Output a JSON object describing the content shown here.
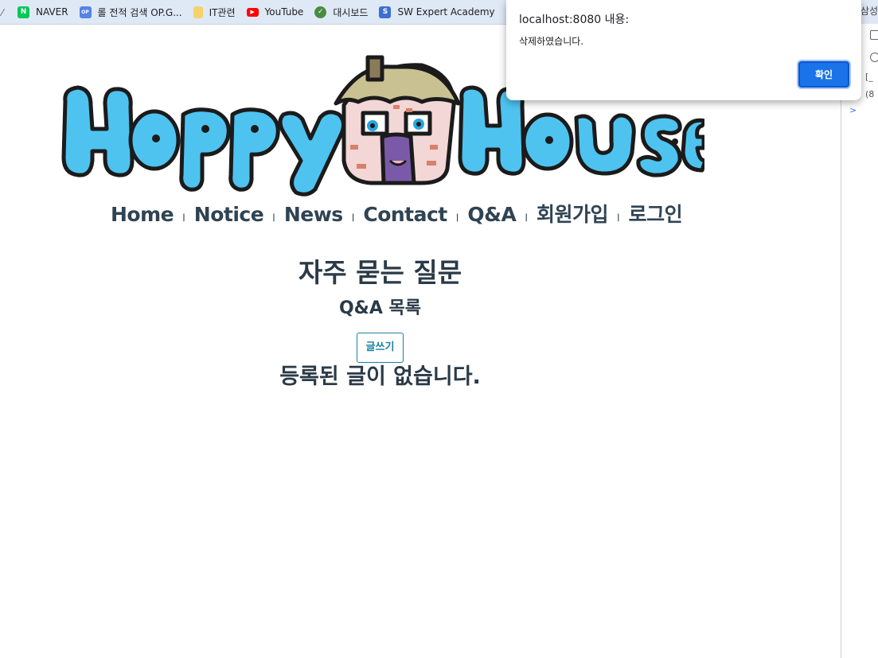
{
  "bookmarks": [
    {
      "label": "NAVER",
      "icon": "naver-icon",
      "color": "#03c75a",
      "glyph": "N"
    },
    {
      "label": "롤 전적 검색 OP.G...",
      "icon": "opgg-icon",
      "color": "#5383e8",
      "glyph": "OP"
    },
    {
      "label": "IT관련",
      "icon": "folder-icon",
      "color": "#f5d36b",
      "glyph": ""
    },
    {
      "label": "YouTube",
      "icon": "youtube-icon",
      "color": "#ff0000",
      "glyph": "▶"
    },
    {
      "label": "대시보드",
      "icon": "dashboard-icon",
      "color": "#4a8c3f",
      "glyph": "✓"
    },
    {
      "label": "SW Expert Academy",
      "icon": "swea-icon",
      "color": "#3b6fd1",
      "glyph": "S"
    }
  ],
  "bookmarks_right": "삼성",
  "nav": [
    "Home",
    "Notice",
    "News",
    "Contact",
    "Q&A",
    "회원가입",
    "로그인"
  ],
  "page": {
    "title": "자주 묻는 질문",
    "subtitle": "Q&A 목록",
    "write_button": "글쓰기",
    "empty_message": "등록된 글이 없습니다."
  },
  "dialog": {
    "title": "localhost:8080 내용:",
    "message": "삭제하였습니다.",
    "ok_label": "확인"
  },
  "devtools": {
    "row1": "[_",
    "row2": "(8",
    "prompt": ">"
  },
  "colors": {
    "logo_blue": "#4ec3f0",
    "nav_text": "#2f4353",
    "button_border": "#1a7fa3",
    "dialog_button": "#1a73e8"
  }
}
